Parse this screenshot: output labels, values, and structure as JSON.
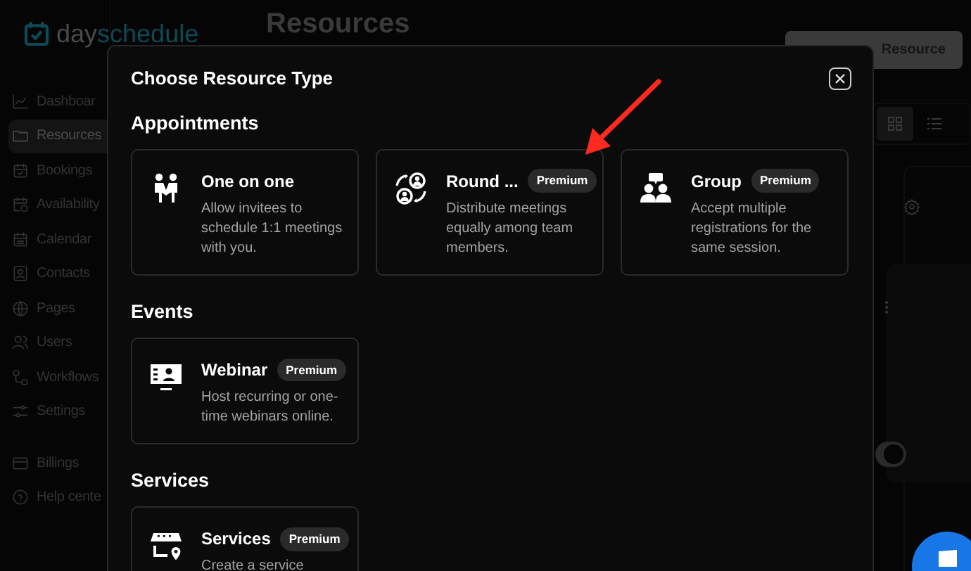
{
  "app": {
    "logo": {
      "prefix": "day",
      "suffix": "schedule"
    },
    "page_title": "Resources",
    "new_button": "Resource",
    "sidebar": [
      {
        "label": "Dashboar",
        "selected": false
      },
      {
        "label": "Resources",
        "selected": true
      },
      {
        "label": "Bookings",
        "selected": false
      },
      {
        "label": "Availability",
        "selected": false
      },
      {
        "label": "Calendar",
        "selected": false
      },
      {
        "label": "Contacts",
        "selected": false
      },
      {
        "label": "Pages",
        "selected": false
      },
      {
        "label": "Users",
        "selected": false
      },
      {
        "label": "Workflows",
        "selected": false
      },
      {
        "label": "Settings",
        "selected": false
      }
    ],
    "sidebar_bottom": [
      {
        "label": "Billings",
        "selected": false
      },
      {
        "label": "Help cente",
        "selected": false
      }
    ],
    "toggle": {
      "on": true
    },
    "view_toggle": [
      {
        "kind": "grid",
        "selected": true
      },
      {
        "kind": "list",
        "selected": false
      }
    ]
  },
  "dialog": {
    "title": "Choose Resource Type",
    "sections": [
      {
        "heading": "Appointments",
        "cards": [
          {
            "title": "One on one",
            "description": "Allow invitees to schedule 1:1 meetings with you."
          },
          {
            "title": "Round ...",
            "badge": "Premium",
            "description": "Distribute meetings equally among team members."
          },
          {
            "title": "Group",
            "badge": "Premium",
            "description": "Accept multiple registrations for the same session."
          }
        ]
      },
      {
        "heading": "Events",
        "cards": [
          {
            "title": "Webinar",
            "badge": "Premium",
            "description": "Host recurring or one-time webinars online."
          }
        ]
      },
      {
        "heading": "Services",
        "cards": [
          {
            "title": "Services",
            "badge": "Premium",
            "description": "Create a service"
          }
        ]
      }
    ]
  }
}
